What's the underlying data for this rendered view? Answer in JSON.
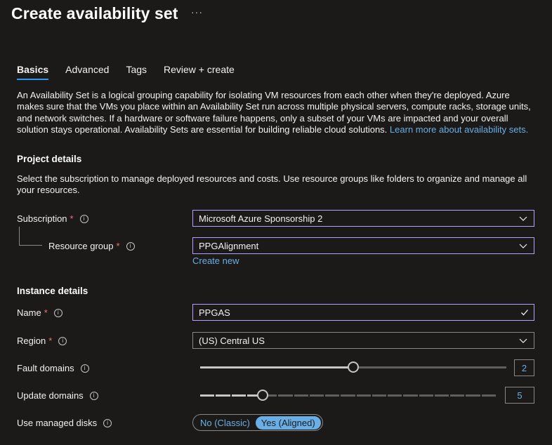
{
  "header": {
    "title": "Create availability set",
    "more": "···"
  },
  "tabs": [
    {
      "label": "Basics",
      "active": true
    },
    {
      "label": "Advanced"
    },
    {
      "label": "Tags"
    },
    {
      "label": "Review + create"
    }
  ],
  "intro": {
    "text": "An Availability Set is a logical grouping capability for isolating VM resources from each other when they're deployed. Azure makes sure that the VMs you place within an Availability Set run across multiple physical servers, compute racks, storage units, and network switches. If a hardware or software failure happens, only a subset of your VMs are impacted and your overall solution stays operational. Availability Sets are essential for building reliable cloud solutions.",
    "link": "Learn more about availability sets."
  },
  "project": {
    "heading": "Project details",
    "description": "Select the subscription to manage deployed resources and costs. Use resource groups like folders to organize and manage all your resources.",
    "subscription_label": "Subscription",
    "subscription_value": "Microsoft Azure Sponsorship 2",
    "resource_group_label": "Resource group",
    "resource_group_value": "PPGAlignment",
    "create_new": "Create new"
  },
  "instance": {
    "heading": "Instance details",
    "name_label": "Name",
    "name_value": "PPGAS",
    "region_label": "Region",
    "region_value": "(US) Central US",
    "fault_label": "Fault domains",
    "fault_value": "2",
    "fault_max": 3,
    "update_label": "Update domains",
    "update_value": "5",
    "update_max": 20,
    "disks_label": "Use managed disks",
    "disks_options": [
      "No (Classic)",
      "Yes (Aligned)"
    ],
    "disks_selected": "Yes (Aligned)"
  },
  "icons": {
    "info": "info-icon",
    "chevron": "chevron-down-icon",
    "check": "checkmark-icon"
  },
  "colors": {
    "accent": "#2899f5",
    "link": "#69afe5",
    "required": "#f1707b",
    "focus_border": "#b4a0ff"
  }
}
